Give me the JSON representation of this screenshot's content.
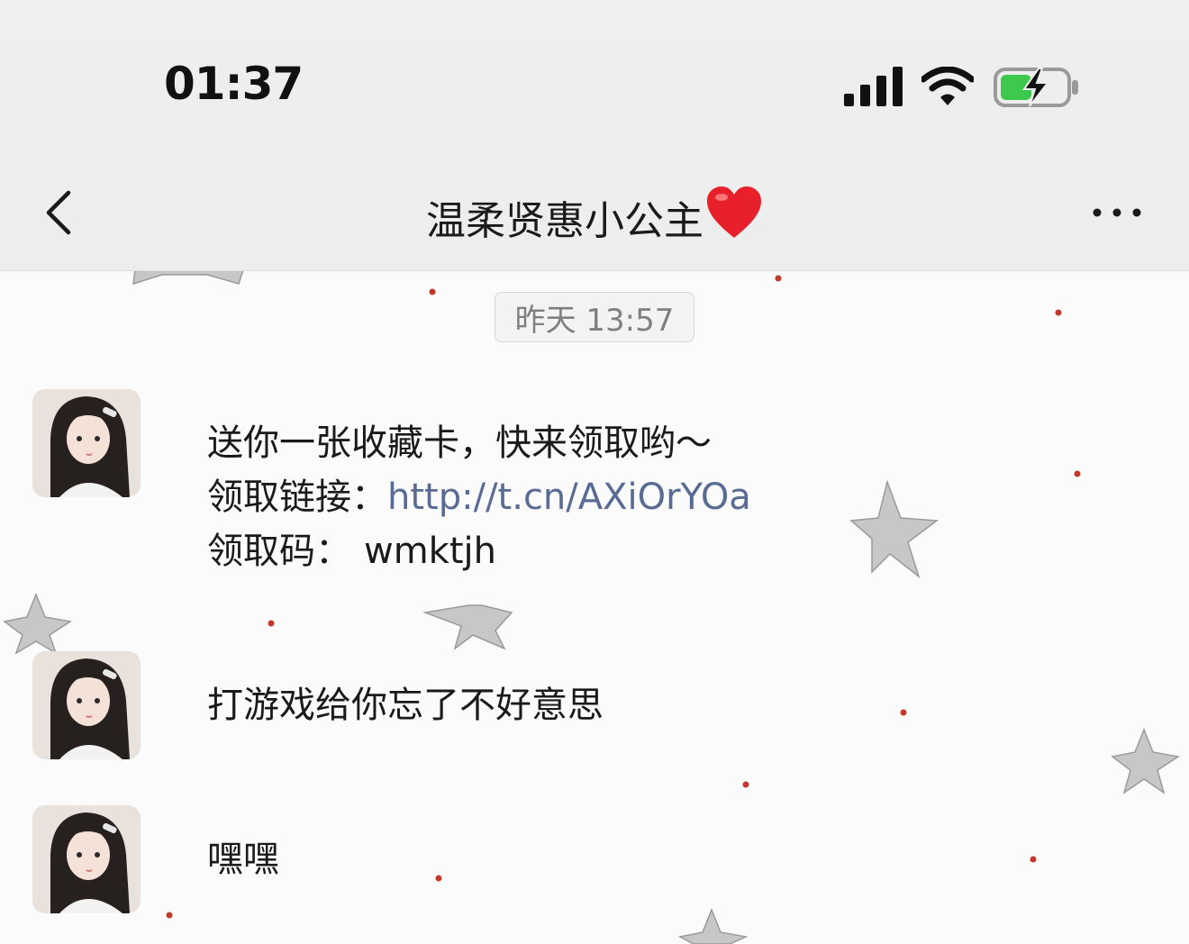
{
  "status_bar": {
    "time": "01:37"
  },
  "header": {
    "title": "温柔贤惠小公主",
    "title_emoji": "❤️"
  },
  "chat": {
    "timestamp": "昨天 13:57",
    "messages": [
      {
        "line1": "送你一张收藏卡，快来领取哟～",
        "line2_label": "领取链接：",
        "line2_link": "http://t.cn/AXiOrYOa",
        "line3_label": "领取码：",
        "line3_code": "wmktjh"
      },
      {
        "text": "打游戏给你忘了不好意思"
      },
      {
        "text": "嘿嘿"
      }
    ]
  },
  "colors": {
    "link": "#576b95",
    "background_dots": "#c0392b",
    "stars": "#c8c8c8"
  }
}
